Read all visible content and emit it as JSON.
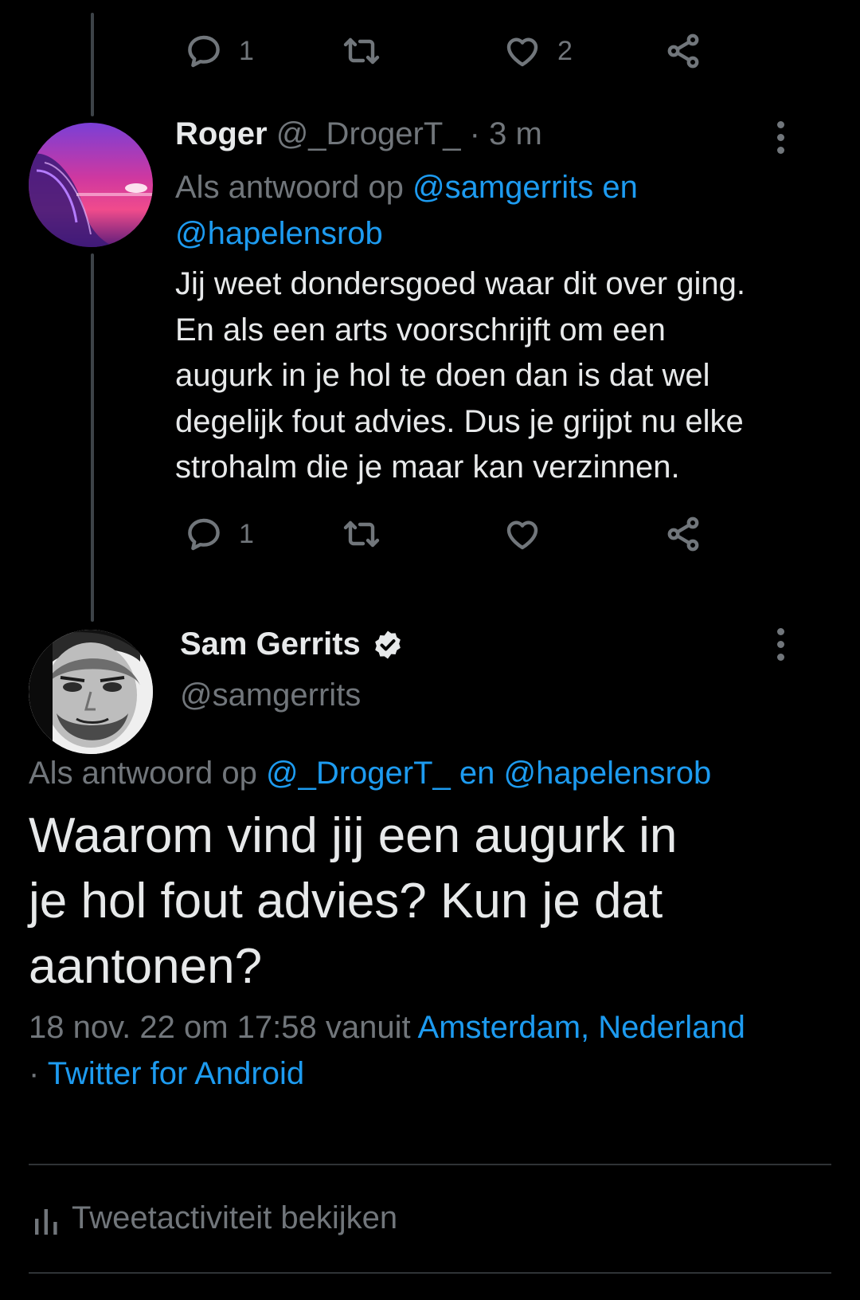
{
  "previous_tweet": {
    "actions": {
      "reply_count": "1",
      "like_count": "2"
    }
  },
  "reply_tweet": {
    "author_name": "Roger",
    "author_handle": "@_DrogerT_",
    "separator": "·",
    "time": "3 m",
    "reply_prefix": "Als antwoord op",
    "reply_to_1": "@samgerrits",
    "reply_conjunction": "en",
    "reply_to_2": "@hapelensrob",
    "text_lines": [
      "Jij weet dondersgoed waar dit over ging.",
      "En als een arts voorschrijft om een",
      "augurk in je hol te doen dan is dat wel",
      "degelijk fout advies. Dus je grijpt nu elke",
      "strohalm die je maar kan verzinnen."
    ],
    "actions": {
      "reply_count": "1"
    }
  },
  "main_tweet": {
    "author_name": "Sam Gerrits",
    "author_handle": "@samgerrits",
    "verified": true,
    "reply_prefix": "Als antwoord op",
    "reply_to_1": "@_DrogerT_",
    "reply_conjunction": "en",
    "reply_to_2": "@hapelensrob",
    "text_lines": [
      "Waarom vind jij een augurk in",
      "je hol fout advies? Kun je dat",
      "aantonen?"
    ],
    "meta_date": "18 nov. 22 om 17:58",
    "meta_from": "vanuit",
    "meta_location": "Amsterdam, Nederland",
    "meta_separator": "·",
    "meta_client": "Twitter for Android",
    "activity_label": "Tweetactiviteit bekijken"
  },
  "colors": {
    "background": "#000000",
    "text": "#e7e9ea",
    "muted": "#71767b",
    "link": "#1d9bf0",
    "divider": "#2f3336"
  },
  "icons": [
    "reply-icon",
    "retweet-icon",
    "like-icon",
    "share-icon",
    "more-icon",
    "verified-badge-icon",
    "analytics-icon"
  ]
}
